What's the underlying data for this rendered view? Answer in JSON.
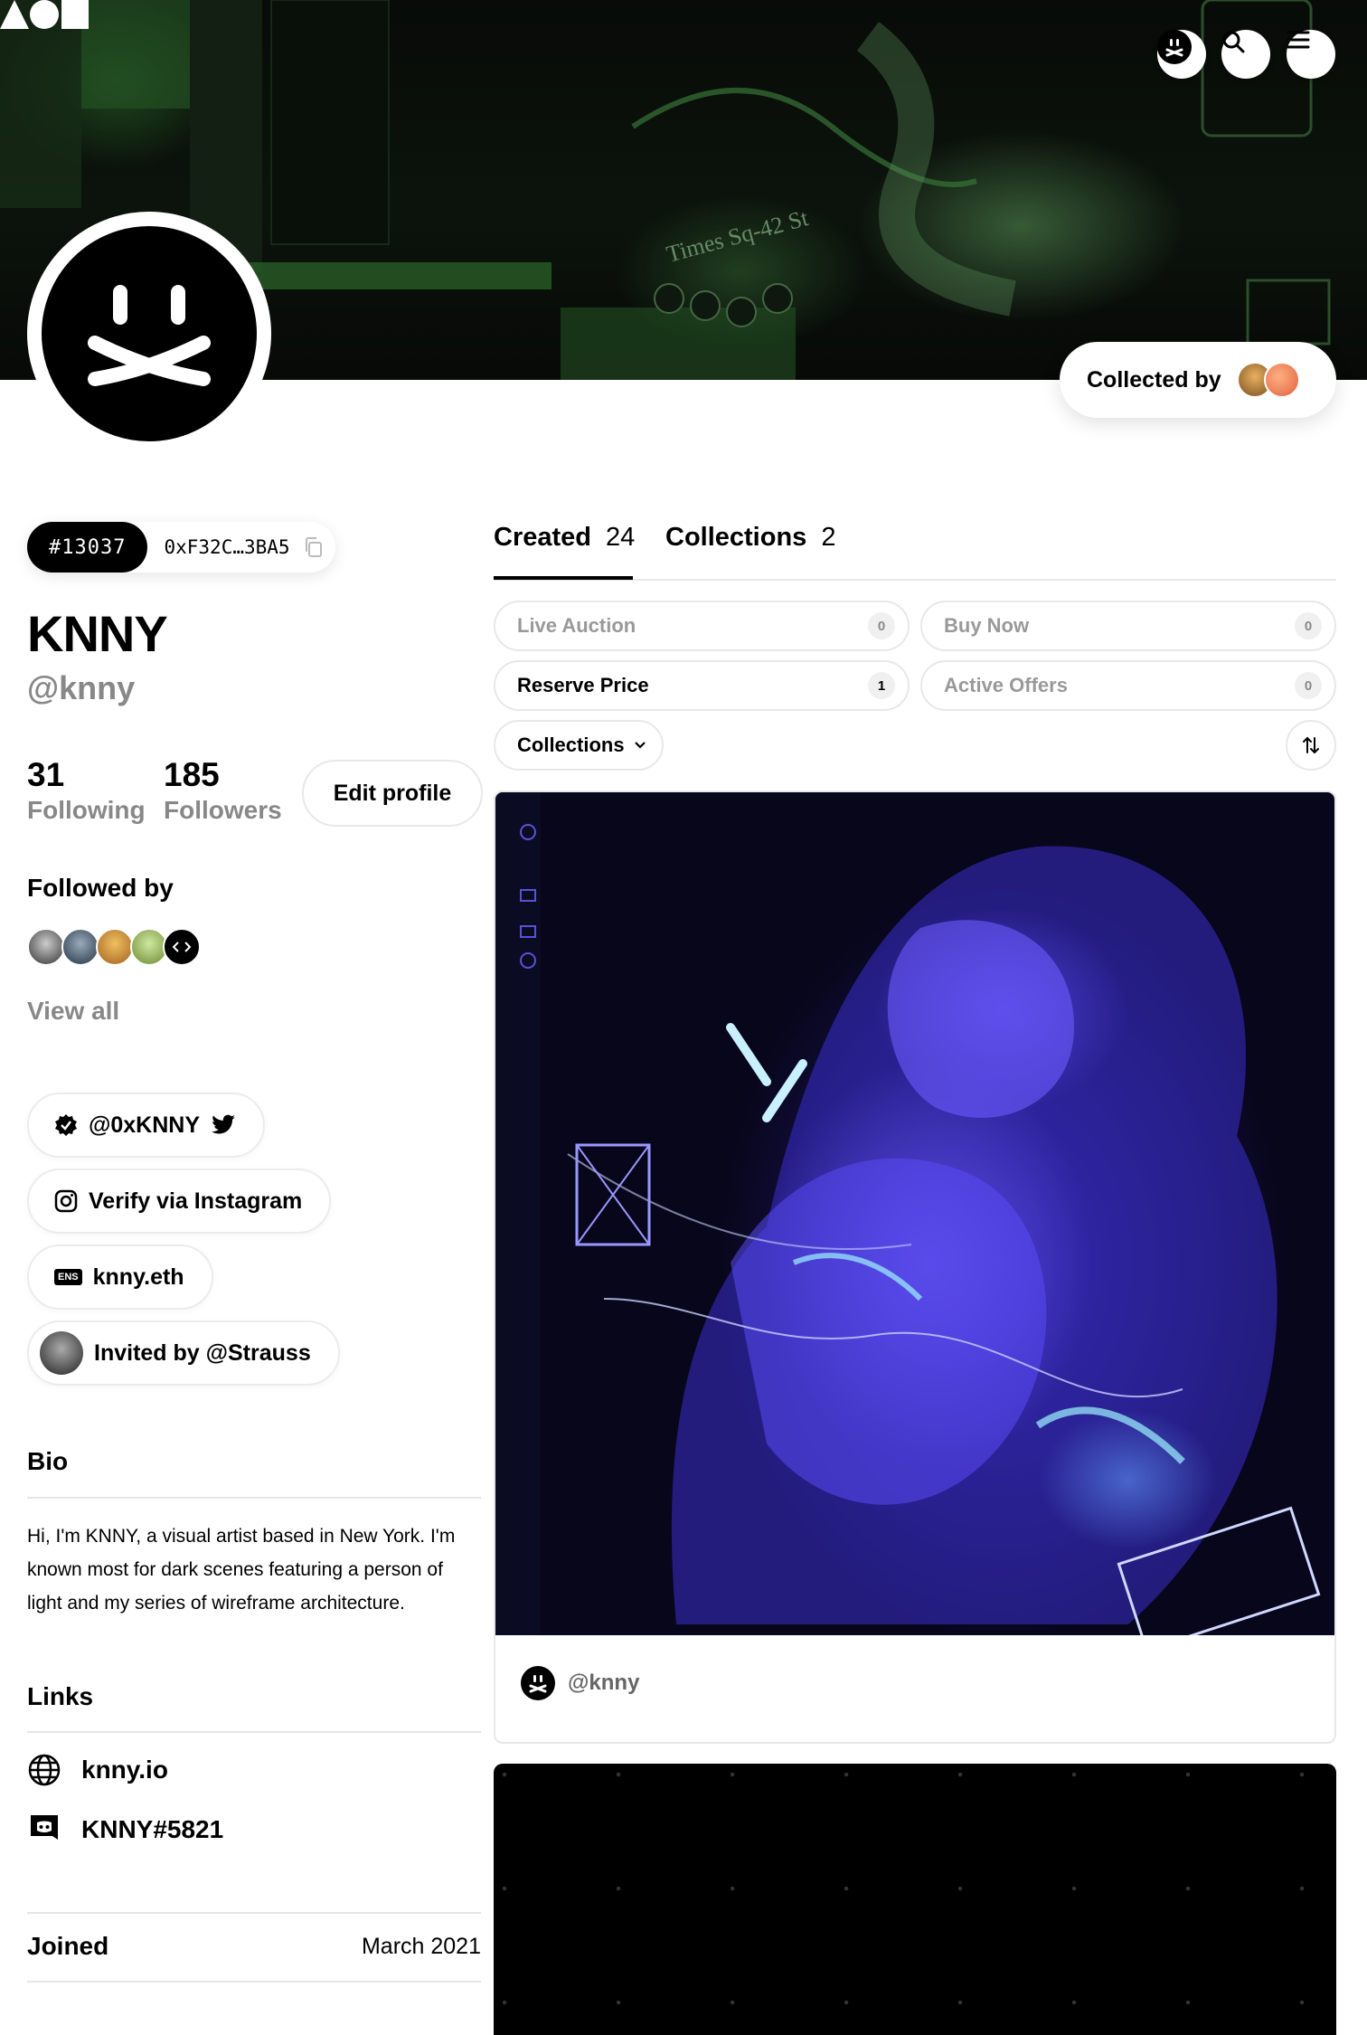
{
  "header": {
    "logo_icon": "aoi-logo",
    "icons": [
      "profile-icon",
      "search-icon",
      "menu-icon"
    ]
  },
  "collected_by": {
    "label": "Collected by"
  },
  "profile": {
    "token_id": "#13037",
    "address": "0xF32C…3BA5",
    "name": "KNNY",
    "handle": "@knny",
    "following_count": "31",
    "following_label": "Following",
    "followers_count": "185",
    "followers_label": "Followers",
    "edit_label": "Edit profile",
    "followed_by_label": "Followed by",
    "view_all_label": "View all"
  },
  "socials": [
    {
      "label": "@0xKNNY",
      "icon": "verified-badge-icon",
      "trail_icon": "twitter-icon"
    },
    {
      "label": "Verify via Instagram",
      "icon": "instagram-icon"
    },
    {
      "label": "knny.eth",
      "icon": "ens-icon",
      "icon_text": "ENS"
    },
    {
      "label": "Invited by @Strauss",
      "icon": "avatar"
    }
  ],
  "bio": {
    "heading": "Bio",
    "text": "Hi, I'm KNNY, a visual artist based in New York. I'm known most for dark scenes featuring a person of light and my series of wireframe architecture."
  },
  "links": {
    "heading": "Links",
    "items": [
      {
        "label": "knny.io",
        "icon": "globe-icon"
      },
      {
        "label": "KNNY#5821",
        "icon": "discord-icon"
      }
    ]
  },
  "joined": {
    "label": "Joined",
    "value": "March 2021"
  },
  "tabs": [
    {
      "label": "Created",
      "count": "24"
    },
    {
      "label": "Collections",
      "count": "2"
    }
  ],
  "filters": [
    {
      "label": "Live Auction",
      "count": "0"
    },
    {
      "label": "Buy Now",
      "count": "0"
    },
    {
      "label": "Reserve Price",
      "count": "1"
    },
    {
      "label": "Active Offers",
      "count": "0"
    }
  ],
  "collections_dropdown": {
    "label": "Collections"
  },
  "artwork_card": {
    "creator": "@knny"
  },
  "colors": {
    "accent": "#000000",
    "muted": "#888888",
    "banner_green": "#3a8a3a",
    "art_violet": "#5b45f0"
  }
}
